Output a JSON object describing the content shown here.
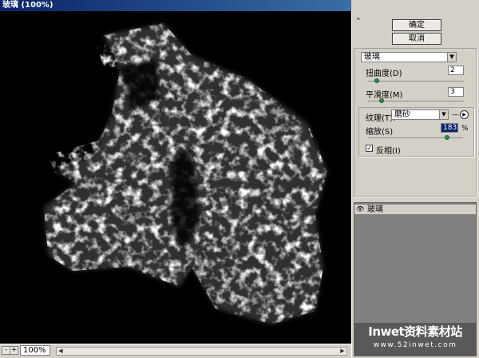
{
  "window": {
    "title": "玻璃 (100%)"
  },
  "panel": {
    "ok_label": "确定",
    "cancel_label": "取消",
    "filter_select": "玻璃",
    "distortion": {
      "label": "扭曲度(D)",
      "value": "2",
      "level": 0.1
    },
    "smoothness": {
      "label": "平滑度(M)",
      "value": "3",
      "level": 0.15
    },
    "texture": {
      "label": "纹理(T):",
      "value": "磨砂"
    },
    "scaling": {
      "label": "缩放(S)",
      "value": "183",
      "unit": "%",
      "level": 0.83
    },
    "invert": {
      "label": "反相(I)",
      "checked": true
    }
  },
  "layers": {
    "items": [
      {
        "label": "玻璃"
      }
    ]
  },
  "zoom": {
    "value": "100%",
    "minus": "-",
    "plus": "+"
  },
  "watermark": {
    "main": "Inwet资料素材站",
    "sub": "www.52inwet.com"
  }
}
